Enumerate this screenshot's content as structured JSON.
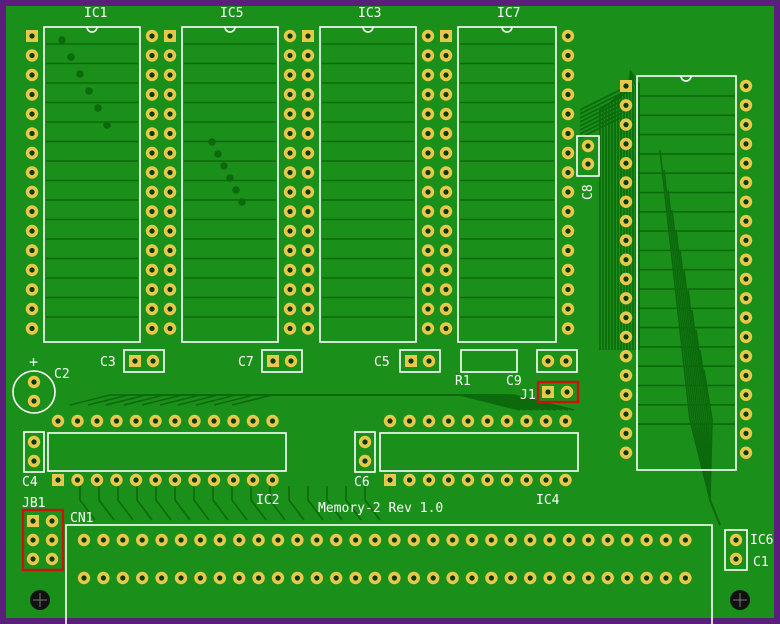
{
  "board": {
    "title": "Memory-2  Rev 1.0",
    "colors": {
      "substrate": "#5a1f7a",
      "copper": "#1a8f1a",
      "trace": "#0a5a0a",
      "silk": "#ffffff",
      "pad": "#e8c84a",
      "jumper": "#cc1111"
    }
  },
  "labels": {
    "ic1": "IC1",
    "ic5": "IC5",
    "ic3": "IC3",
    "ic7": "IC7",
    "c2": "C2",
    "c3": "C3",
    "c7": "C7",
    "c5": "C5",
    "r1": "R1",
    "c9": "C9",
    "j1": "J1",
    "c8": "C8",
    "c4": "C4",
    "ic2": "IC2",
    "c6": "C6",
    "ic4": "IC4",
    "jb1": "JB1",
    "cn1": "CN1",
    "ic6": "IC6",
    "c1": "C1",
    "plus": "+"
  }
}
